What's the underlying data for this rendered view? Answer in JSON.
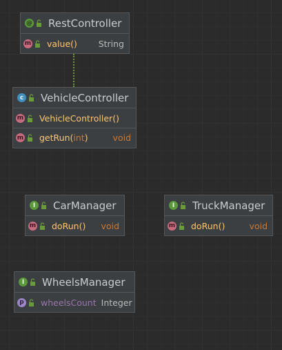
{
  "colors": {
    "background": "#2b2b2b",
    "node_background": "#3c3f41",
    "method_name": "#ffc66d",
    "keyword": "#cc7832",
    "field": "#9876aa",
    "connector": "#6a9b3a"
  },
  "nodes": {
    "rest_controller": {
      "kind_icon": "annotation-icon",
      "title": "RestController",
      "members": [
        {
          "icon": "method-icon",
          "name": "value",
          "suffix": "()",
          "type": "String"
        }
      ]
    },
    "vehicle_controller": {
      "kind_icon": "class-icon",
      "title": "VehicleController",
      "members": [
        {
          "icon": "method-icon",
          "name": "VehicleController",
          "suffix": "()",
          "type": ""
        },
        {
          "icon": "method-icon",
          "name": "getRun",
          "open": "(",
          "param": "int",
          "close": ")",
          "type": "void"
        }
      ]
    },
    "car_manager": {
      "kind_icon": "interface-icon",
      "title": "CarManager",
      "members": [
        {
          "icon": "method-icon",
          "name": "doRun",
          "suffix": "()",
          "type": "void"
        }
      ]
    },
    "truck_manager": {
      "kind_icon": "interface-icon",
      "title": "TruckManager",
      "members": [
        {
          "icon": "method-icon",
          "name": "doRun",
          "suffix": "()",
          "type": "void"
        }
      ]
    },
    "wheels_manager": {
      "kind_icon": "interface-icon",
      "title": "WheelsManager",
      "members": [
        {
          "icon": "field-icon",
          "name": "wheelsCount",
          "type": "Integer"
        }
      ]
    }
  }
}
